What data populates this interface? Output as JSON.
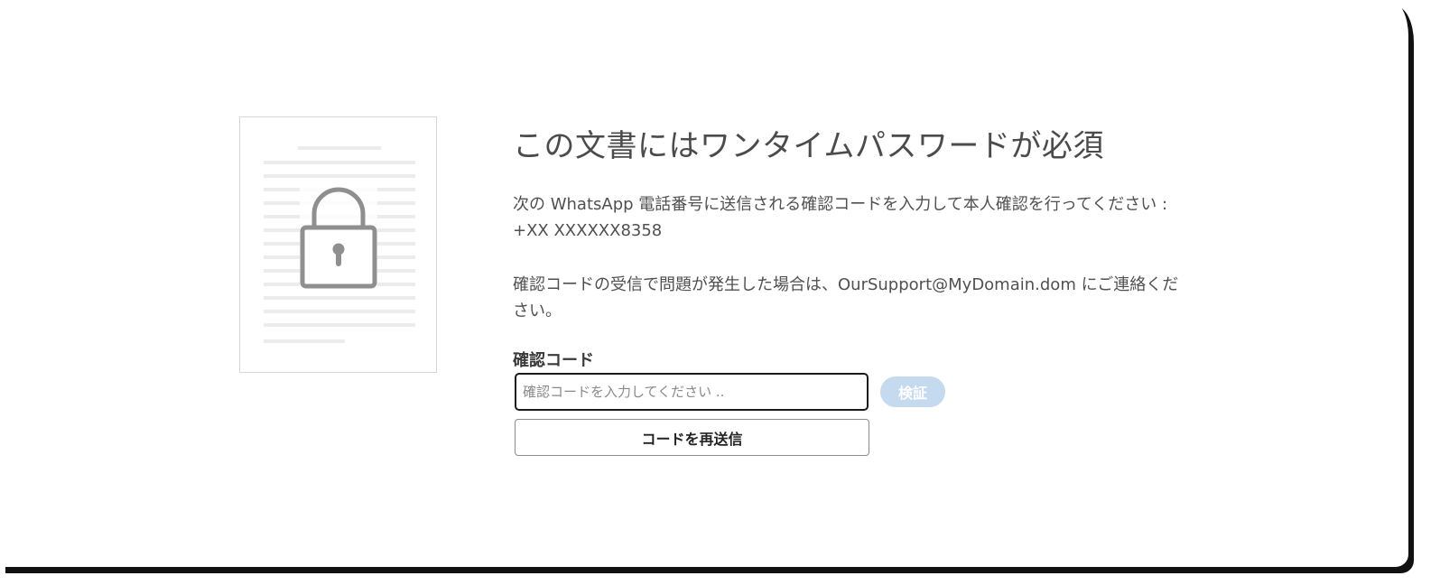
{
  "page": {
    "title": "この文書にはワンタイムパスワードが必須",
    "instruction": "次の WhatsApp 電話番号に送信される確認コードを入力して本人確認を行ってください : +XX XXXXXX8358",
    "support_note": "確認コードの受信で問題が発生した場合は、OurSupport@MyDomain.dom にご連絡ください。"
  },
  "form": {
    "code_label": "確認コード",
    "code_placeholder": "確認コードを入力してください ..",
    "code_value": "",
    "verify_label": "検証",
    "resend_label": "コードを再送信"
  },
  "illustration": {
    "icon": "lock-icon"
  },
  "colors": {
    "verify_button_bg": "#c5d9ef",
    "title_text": "#4b4b4b",
    "input_border": "#1a1a1a"
  }
}
